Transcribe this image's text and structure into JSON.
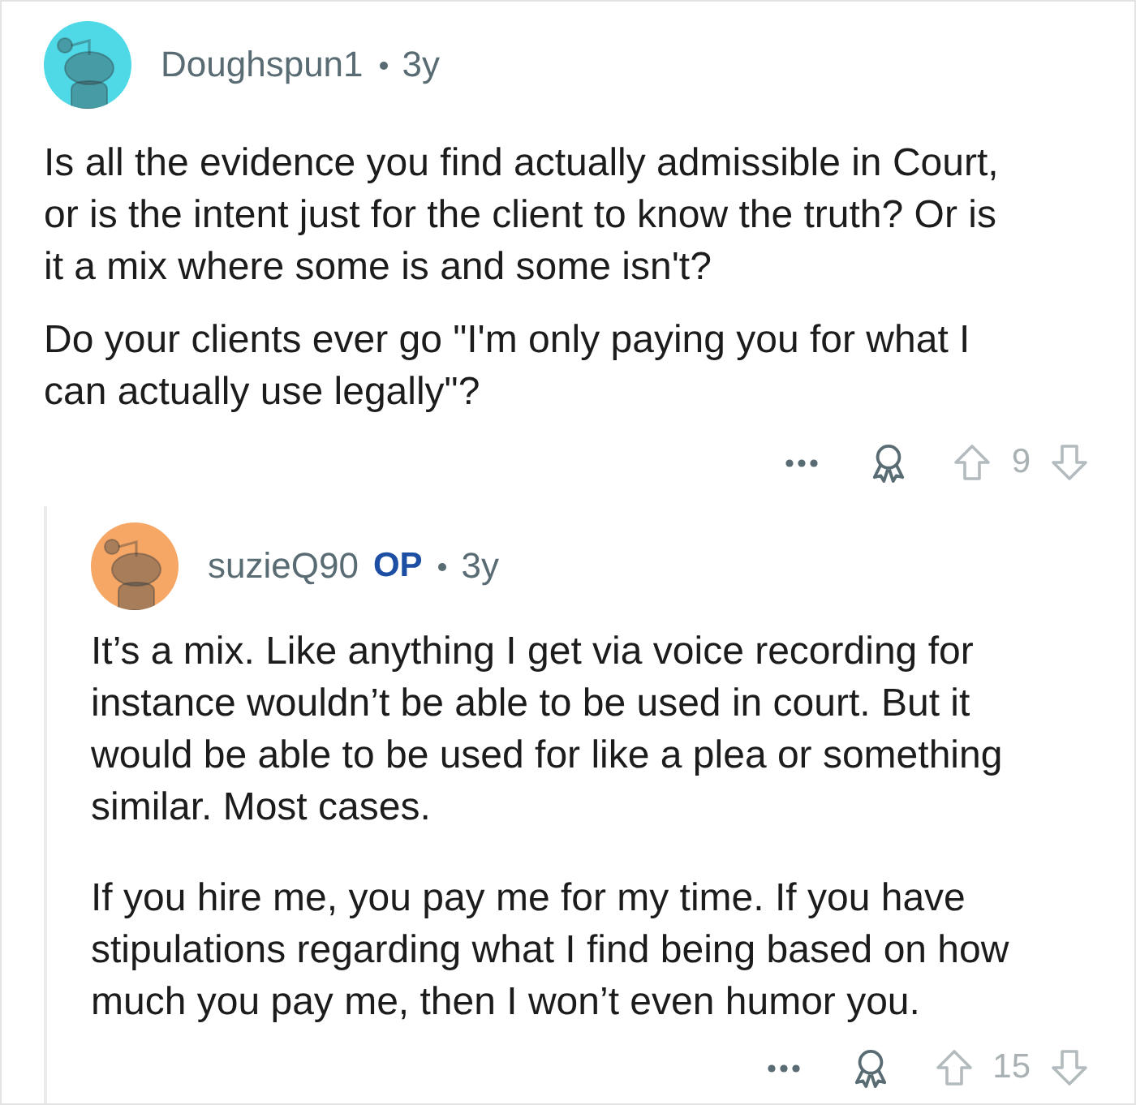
{
  "comments": [
    {
      "author": "Doughspun1",
      "age": "3y",
      "color": "#4fd9e6",
      "paragraphs": [
        "Is all the evidence you find actually admissible in Court, or is the intent just for the client to know the truth? Or is it a mix where some is and some isn't?",
        "Do your clients ever go \"I'm only paying you for what I can actually use legally\"?"
      ],
      "score": "9",
      "children": [
        {
          "author": "suzieQ90",
          "badge": "OP",
          "age": "3y",
          "color": "#f6a665",
          "paragraphs": [
            "It’s a mix. Like anything I get via voice recording for instance wouldn’t be able to be used in court. But it would be able to be used for like a plea or something similar. Most cases.",
            "If you hire me, you pay me for my time. If you have stipulations regarding what I find being based on how much you pay me, then I won’t even humor you."
          ],
          "score": "15"
        }
      ]
    }
  ]
}
